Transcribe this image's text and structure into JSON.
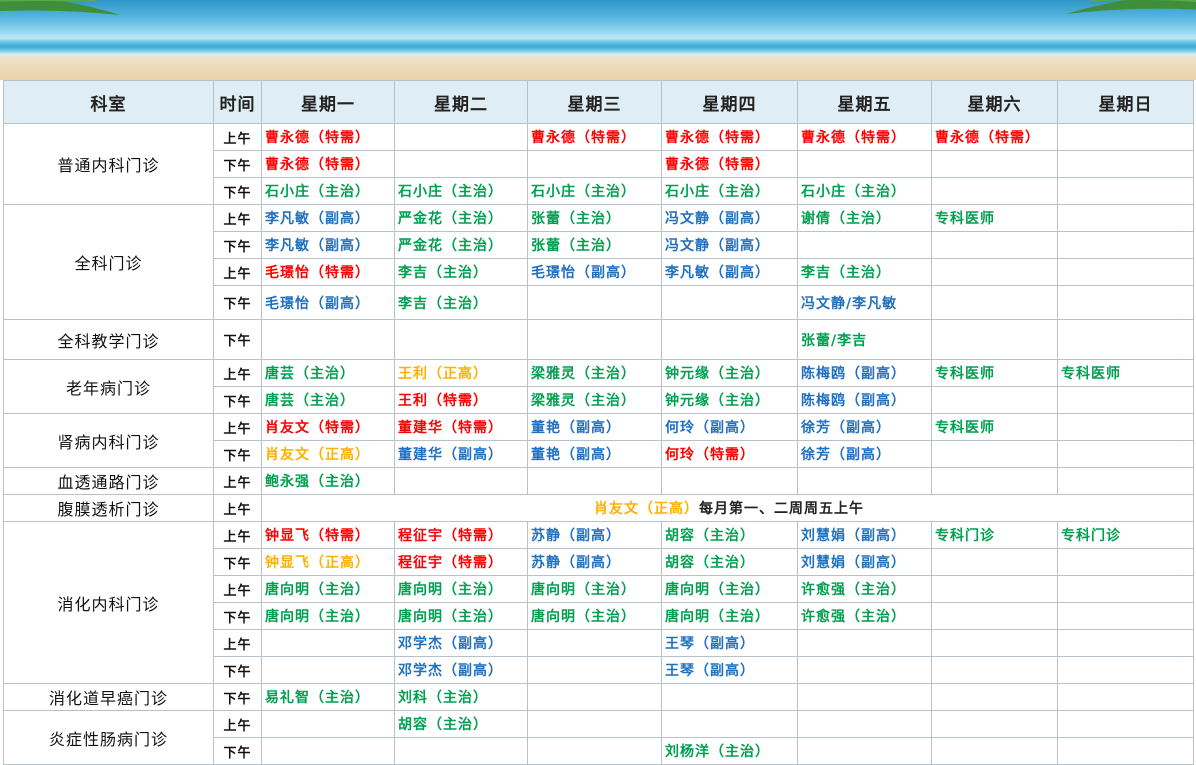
{
  "colors": {
    "red": "#ff0000",
    "green": "#00a050",
    "blue": "#2070c0",
    "gold": "#ffb000",
    "header_bg": "#dfeef5"
  },
  "headers": [
    "科室",
    "时间",
    "星期一",
    "星期二",
    "星期三",
    "星期四",
    "星期五",
    "星期六",
    "星期日"
  ],
  "rows": [
    {
      "dept": "普通内科门诊",
      "span": 3,
      "h": 27,
      "time": "上午",
      "cells": [
        [
          "曹永德（特需）",
          "red"
        ],
        [
          "",
          ""
        ],
        [
          "曹永德（特需）",
          "red"
        ],
        [
          "曹永德（特需）",
          "red"
        ],
        [
          "曹永德（特需）",
          "red"
        ],
        [
          "曹永德（特需）",
          "red"
        ],
        [
          "",
          ""
        ]
      ]
    },
    {
      "h": 27,
      "time": "下午",
      "cells": [
        [
          "曹永德（特需）",
          "red"
        ],
        [
          "",
          ""
        ],
        [
          "",
          ""
        ],
        [
          "曹永德（特需）",
          "red"
        ],
        [
          "",
          ""
        ],
        [
          "",
          ""
        ],
        [
          "",
          ""
        ]
      ]
    },
    {
      "h": 27,
      "time": "下午",
      "cells": [
        [
          "石小庄（主治）",
          "green"
        ],
        [
          "石小庄（主治）",
          "green"
        ],
        [
          "石小庄（主治）",
          "green"
        ],
        [
          "石小庄（主治）",
          "green"
        ],
        [
          "石小庄（主治）",
          "green"
        ],
        [
          "",
          ""
        ],
        [
          "",
          ""
        ]
      ]
    },
    {
      "dept": "全科门诊",
      "span": 4,
      "h": 27,
      "time": "上午",
      "cells": [
        [
          "李凡敏（副高）",
          "blue"
        ],
        [
          "严金花（主治）",
          "green"
        ],
        [
          "张蕾（主治）",
          "green"
        ],
        [
          "冯文静（副高）",
          "blue"
        ],
        [
          "谢倩（主治）",
          "green"
        ],
        [
          "专科医师",
          "green"
        ],
        [
          "",
          ""
        ]
      ]
    },
    {
      "h": 27,
      "time": "下午",
      "cells": [
        [
          "李凡敏（副高）",
          "blue"
        ],
        [
          "严金花（主治）",
          "green"
        ],
        [
          "张蕾（主治）",
          "green"
        ],
        [
          "冯文静（副高）",
          "blue"
        ],
        [
          "",
          ""
        ],
        [
          "",
          ""
        ],
        [
          "",
          ""
        ]
      ]
    },
    {
      "h": 27,
      "time": "上午",
      "cells": [
        [
          "毛璟怡（特需）",
          "red"
        ],
        [
          "李吉（主治）",
          "green"
        ],
        [
          "毛璟怡（副高）",
          "blue"
        ],
        [
          "李凡敏（副高）",
          "blue"
        ],
        [
          "李吉（主治）",
          "green"
        ],
        [
          "",
          ""
        ],
        [
          "",
          ""
        ]
      ]
    },
    {
      "h": 34,
      "time": "下午",
      "cells": [
        [
          "毛璟怡（副高）",
          "blue"
        ],
        [
          "李吉（主治）",
          "green"
        ],
        [
          "",
          ""
        ],
        [
          "",
          ""
        ],
        [
          "冯文静/李凡敏",
          "blue"
        ],
        [
          "",
          ""
        ],
        [
          "",
          ""
        ]
      ]
    },
    {
      "dept": "全科教学门诊",
      "span": 1,
      "h": 40,
      "time": "下午",
      "cells": [
        [
          "",
          ""
        ],
        [
          "",
          ""
        ],
        [
          "",
          ""
        ],
        [
          "",
          ""
        ],
        [
          "张蕾/李吉",
          "green"
        ],
        [
          "",
          ""
        ],
        [
          "",
          ""
        ]
      ]
    },
    {
      "dept": "老年病门诊",
      "span": 2,
      "h": 27,
      "time": "上午",
      "cells": [
        [
          "唐芸（主治）",
          "green"
        ],
        [
          "王利（正高）",
          "gold"
        ],
        [
          "梁雅灵（主治）",
          "green"
        ],
        [
          "钟元缘（主治）",
          "green"
        ],
        [
          "陈梅鸥（副高）",
          "blue"
        ],
        [
          "专科医师",
          "green"
        ],
        [
          "专科医师",
          "green"
        ]
      ]
    },
    {
      "h": 27,
      "time": "下午",
      "cells": [
        [
          "唐芸（主治）",
          "green"
        ],
        [
          "王利（特需）",
          "red"
        ],
        [
          "梁雅灵（主治）",
          "green"
        ],
        [
          "钟元缘（主治）",
          "green"
        ],
        [
          "陈梅鸥（副高）",
          "blue"
        ],
        [
          "",
          ""
        ],
        [
          "",
          ""
        ]
      ]
    },
    {
      "dept": "肾病内科门诊",
      "span": 2,
      "h": 27,
      "time": "上午",
      "cells": [
        [
          "肖友文（特需）",
          "red"
        ],
        [
          "董建华（特需）",
          "red"
        ],
        [
          "董艳（副高）",
          "blue"
        ],
        [
          "何玲（副高）",
          "blue"
        ],
        [
          "徐芳（副高）",
          "blue"
        ],
        [
          "专科医师",
          "green"
        ],
        [
          "",
          ""
        ]
      ]
    },
    {
      "h": 27,
      "time": "下午",
      "cells": [
        [
          "肖友文（正高）",
          "gold"
        ],
        [
          "董建华（副高）",
          "blue"
        ],
        [
          "董艳（副高）",
          "blue"
        ],
        [
          "何玲（特需）",
          "red"
        ],
        [
          "徐芳（副高）",
          "blue"
        ],
        [
          "",
          ""
        ],
        [
          "",
          ""
        ]
      ]
    },
    {
      "dept": "血透通路门诊",
      "span": 1,
      "h": 27,
      "time": "上午",
      "cells": [
        [
          "鲍永强（主治）",
          "green"
        ],
        [
          "",
          ""
        ],
        [
          "",
          ""
        ],
        [
          "",
          ""
        ],
        [
          "",
          ""
        ],
        [
          "",
          ""
        ],
        [
          "",
          ""
        ]
      ]
    },
    {
      "dept": "腹膜透析门诊",
      "span": 1,
      "h": 27,
      "time": "上午",
      "merged": {
        "part1": "肖友文（正高）",
        "part2": "每月第一、二周周五上午"
      }
    },
    {
      "dept": "消化内科门诊",
      "span": 6,
      "h": 27,
      "time": "上午",
      "cells": [
        [
          "钟显飞（特需）",
          "red"
        ],
        [
          "程征宇（特需）",
          "red"
        ],
        [
          "苏静（副高）",
          "blue"
        ],
        [
          "胡容（主治）",
          "green"
        ],
        [
          "刘慧娟（副高）",
          "blue"
        ],
        [
          "专科门诊",
          "green"
        ],
        [
          "专科门诊",
          "green"
        ]
      ]
    },
    {
      "h": 27,
      "time": "下午",
      "cells": [
        [
          "钟显飞（正高）",
          "gold"
        ],
        [
          "程征宇（特需）",
          "red"
        ],
        [
          "苏静（副高）",
          "blue"
        ],
        [
          "胡容（主治）",
          "green"
        ],
        [
          "刘慧娟（副高）",
          "blue"
        ],
        [
          "",
          ""
        ],
        [
          "",
          ""
        ]
      ]
    },
    {
      "h": 27,
      "time": "上午",
      "cells": [
        [
          "唐向明（主治）",
          "green"
        ],
        [
          "唐向明（主治）",
          "green"
        ],
        [
          "唐向明（主治）",
          "green"
        ],
        [
          "唐向明（主治）",
          "green"
        ],
        [
          "许愈强（主治）",
          "green"
        ],
        [
          "",
          ""
        ],
        [
          "",
          ""
        ]
      ]
    },
    {
      "h": 27,
      "time": "下午",
      "cells": [
        [
          "唐向明（主治）",
          "green"
        ],
        [
          "唐向明（主治）",
          "green"
        ],
        [
          "唐向明（主治）",
          "green"
        ],
        [
          "唐向明（主治）",
          "green"
        ],
        [
          "许愈强（主治）",
          "green"
        ],
        [
          "",
          ""
        ],
        [
          "",
          ""
        ]
      ]
    },
    {
      "h": 27,
      "time": "上午",
      "cells": [
        [
          "",
          ""
        ],
        [
          "邓学杰（副高）",
          "blue"
        ],
        [
          "",
          ""
        ],
        [
          "王琴（副高）",
          "blue"
        ],
        [
          "",
          ""
        ],
        [
          "",
          ""
        ],
        [
          "",
          ""
        ]
      ]
    },
    {
      "h": 27,
      "time": "下午",
      "cells": [
        [
          "",
          ""
        ],
        [
          "邓学杰（副高）",
          "blue"
        ],
        [
          "",
          ""
        ],
        [
          "王琴（副高）",
          "blue"
        ],
        [
          "",
          ""
        ],
        [
          "",
          ""
        ],
        [
          "",
          ""
        ]
      ]
    },
    {
      "dept": "消化道早癌门诊",
      "span": 1,
      "h": 27,
      "time": "下午",
      "cells": [
        [
          "易礼智（主治）",
          "green"
        ],
        [
          "刘科（主治）",
          "green"
        ],
        [
          "",
          ""
        ],
        [
          "",
          ""
        ],
        [
          "",
          ""
        ],
        [
          "",
          ""
        ],
        [
          "",
          ""
        ]
      ]
    },
    {
      "dept": "炎症性肠病门诊",
      "span": 2,
      "h": 27,
      "time": "上午",
      "cells": [
        [
          "",
          ""
        ],
        [
          "胡容（主治）",
          "green"
        ],
        [
          "",
          ""
        ],
        [
          "",
          ""
        ],
        [
          "",
          ""
        ],
        [
          "",
          ""
        ],
        [
          "",
          ""
        ]
      ]
    },
    {
      "h": 27,
      "time": "下午",
      "cells": [
        [
          "",
          ""
        ],
        [
          "",
          ""
        ],
        [
          "",
          ""
        ],
        [
          "刘杨洋（主治）",
          "green"
        ],
        [
          "",
          ""
        ],
        [
          "",
          ""
        ],
        [
          "",
          ""
        ]
      ]
    }
  ]
}
